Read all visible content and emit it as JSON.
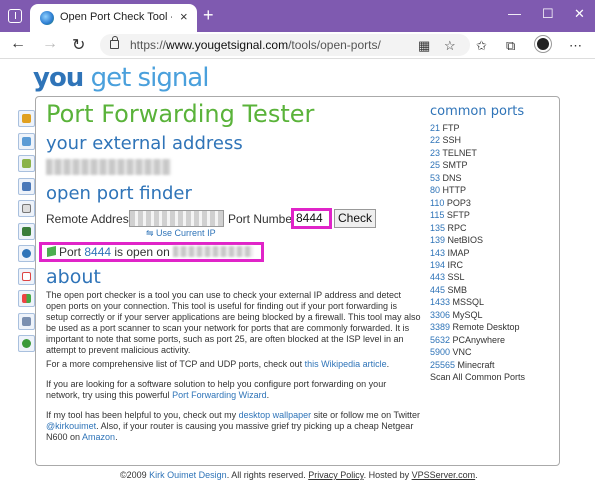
{
  "browser": {
    "tab_title": "Open Port Check Tool - Test Port",
    "tab_close": "×",
    "new_tab": "+",
    "url_prefix": "https://",
    "url_host": "www.yougetsignal.com",
    "url_path": "/tools/open-ports/",
    "window_controls": {
      "minimize": "—",
      "maximize": "☐",
      "close": "✕"
    },
    "nav": {
      "back": "←",
      "forward": "→",
      "reload": "↻"
    },
    "toolbar_icons": [
      "grid-icon",
      "star-add-icon",
      "favorites-icon",
      "collections-icon",
      "profile-icon",
      "more-icon"
    ],
    "accent_color": "#7f5ab0"
  },
  "site": {
    "logo_you": "you",
    "logo_rest": " get signal",
    "title": "Port Forwarding Tester",
    "external_heading": "your external address",
    "finder_heading": "open port finder",
    "remote_label": "Remote Address",
    "use_current": "Use Current IP",
    "port_label": "Port Number",
    "port_value": "8444",
    "check_label": "Check",
    "result_prefix": "Port ",
    "result_port": "8444",
    "result_middle": " is open on ",
    "about_heading": "about",
    "p1": "The open port checker is a tool you can use to check your external IP address and detect open ports on your connection. This tool is useful for finding out if your port forwarding is setup correctly or if your server applications are being blocked by a firewall. This tool may also be used as a port scanner to scan your network for ports that are commonly forwarded. It is important to note that some ports, such as port 25, are often blocked at the ISP level in an attempt to prevent malicious activity.",
    "p2_text": "For a more comprehensive list of TCP and UDP ports, check out ",
    "p2_link": "this Wikipedia article",
    "p2_end": ".",
    "p3_text": "If you are looking for a software solution to help you configure port forwarding on your network, try using this powerful ",
    "p3_link": "Port Forwarding Wizard",
    "p3_end": ".",
    "p4_a": "If my tool has been helpful to you, check out my ",
    "p4_link1": "desktop wallpaper",
    "p4_b": " site or follow me on Twitter ",
    "p4_link2": "@kirkouimet",
    "p4_c": ". Also, if your router is causing you massive grief try picking up a cheap Netgear N600 on ",
    "p4_link3": "Amazon",
    "p4_end": ".",
    "common_heading": "common ports",
    "common_ports": [
      {
        "num": "21",
        "name": " FTP"
      },
      {
        "num": "22",
        "name": " SSH"
      },
      {
        "num": "23",
        "name": " TELNET"
      },
      {
        "num": "25",
        "name": " SMTP"
      },
      {
        "num": "53",
        "name": " DNS"
      },
      {
        "num": "80",
        "name": " HTTP"
      },
      {
        "num": "110",
        "name": " POP3"
      },
      {
        "num": "115",
        "name": " SFTP"
      },
      {
        "num": "135",
        "name": " RPC"
      },
      {
        "num": "139",
        "name": " NetBIOS"
      },
      {
        "num": "143",
        "name": " IMAP"
      },
      {
        "num": "194",
        "name": " IRC"
      },
      {
        "num": "443",
        "name": " SSL"
      },
      {
        "num": "445",
        "name": " SMB"
      },
      {
        "num": "1433",
        "name": " MSSQL"
      },
      {
        "num": "3306",
        "name": " MySQL"
      },
      {
        "num": "3389",
        "name": " Remote Desktop"
      },
      {
        "num": "5632",
        "name": " PCAnywhere"
      },
      {
        "num": "5900",
        "name": " VNC"
      },
      {
        "num": "25565",
        "name": " Minecraft"
      },
      {
        "num": "",
        "name": "Scan All Common Ports"
      }
    ],
    "footer_a": "©2009 ",
    "footer_author": "Kirk Ouimet Design",
    "footer_b": ". All rights reserved. ",
    "footer_privacy": "Privacy Policy",
    "footer_c": ". Hosted by ",
    "footer_host": "VPSServer.com",
    "footer_end": ".",
    "highlight_color": "#e024c8",
    "title_color": "#5ab33a",
    "link_color": "#2f74b8"
  }
}
